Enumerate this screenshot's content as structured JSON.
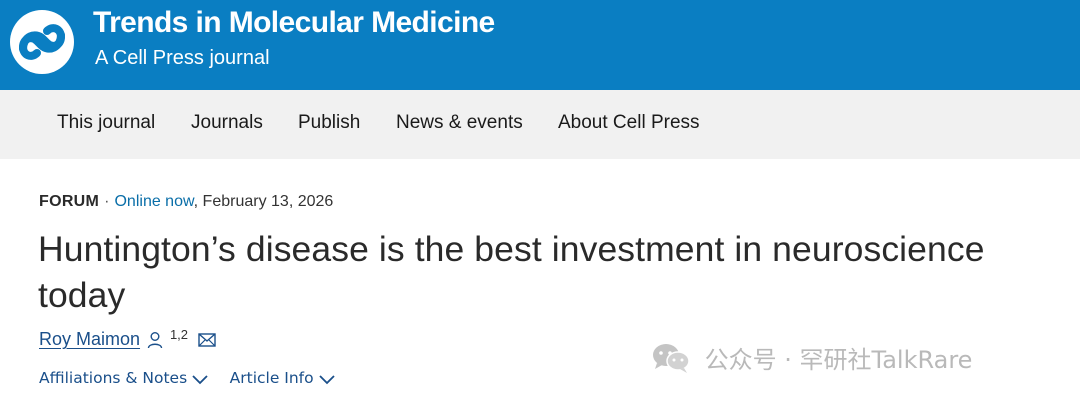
{
  "header": {
    "journal_title": "Trends in Molecular Medicine",
    "journal_subtitle": "A Cell Press journal",
    "brand_color": "#0a7ec2"
  },
  "nav": {
    "items": [
      {
        "label": "This journal"
      },
      {
        "label": "Journals"
      },
      {
        "label": "Publish"
      },
      {
        "label": "News & events"
      },
      {
        "label": "About Cell Press"
      }
    ]
  },
  "article": {
    "type": "FORUM",
    "separator": "·",
    "online_label": "Online now",
    "date": ", February 13, 2026",
    "title": "Huntington’s disease is the best investment in neuroscience today",
    "author": {
      "name": "Roy Maimon",
      "affiliations": "1,2"
    },
    "links": {
      "affiliations": "Affiliations & Notes",
      "article_info": "Article Info"
    }
  },
  "watermark": {
    "text": "公众号 · 罕研社TalkRare",
    "icon": "wechat-icon"
  }
}
